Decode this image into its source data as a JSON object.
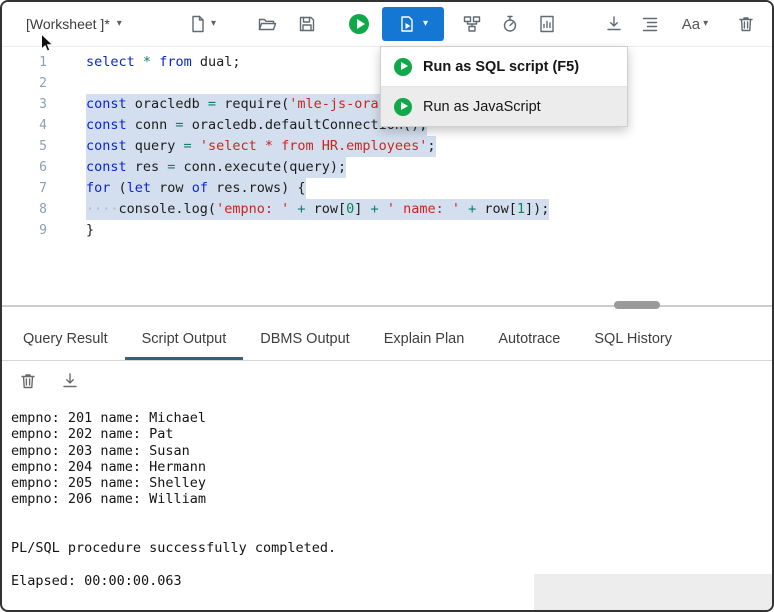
{
  "toolbar": {
    "worksheet_label": "[Worksheet ]*",
    "font_button_label": "Aa",
    "icons": [
      "new-worksheet",
      "open-file",
      "save",
      "run-statement",
      "run-script",
      "explain-plan",
      "autotrace",
      "serial-statements",
      "download",
      "format",
      "font-size",
      "clear"
    ]
  },
  "run_menu": {
    "items": [
      {
        "label": "Run as SQL script (F5)",
        "hovered": false,
        "emphasis": true
      },
      {
        "label": "Run as JavaScript",
        "hovered": true,
        "emphasis": false
      }
    ]
  },
  "editor": {
    "lines": [
      {
        "num": "1",
        "selected": false,
        "tokens": [
          {
            "t": "select",
            "c": "kw"
          },
          {
            "t": " ",
            "c": "pl"
          },
          {
            "t": "*",
            "c": "op"
          },
          {
            "t": " ",
            "c": "pl"
          },
          {
            "t": "from",
            "c": "kw"
          },
          {
            "t": " dual;",
            "c": "pl"
          }
        ]
      },
      {
        "num": "2",
        "selected": false,
        "tokens": []
      },
      {
        "num": "3",
        "selected": true,
        "tokens": [
          {
            "t": "const",
            "c": "kw"
          },
          {
            "t": " oracledb ",
            "c": "pl"
          },
          {
            "t": "=",
            "c": "op"
          },
          {
            "t": " require(",
            "c": "pl"
          },
          {
            "t": "'mle-js-oracledb'",
            "c": "str"
          },
          {
            "t": ");",
            "c": "pl"
          }
        ]
      },
      {
        "num": "4",
        "selected": true,
        "tokens": [
          {
            "t": "const",
            "c": "kw"
          },
          {
            "t": " conn ",
            "c": "pl"
          },
          {
            "t": "=",
            "c": "op"
          },
          {
            "t": " oracledb.defaultConnection();",
            "c": "pl"
          }
        ]
      },
      {
        "num": "5",
        "selected": true,
        "tokens": [
          {
            "t": "const",
            "c": "kw"
          },
          {
            "t": " query ",
            "c": "pl"
          },
          {
            "t": "=",
            "c": "op"
          },
          {
            "t": " ",
            "c": "pl"
          },
          {
            "t": "'select * from HR.employees'",
            "c": "str"
          },
          {
            "t": ";",
            "c": "pl"
          }
        ]
      },
      {
        "num": "6",
        "selected": true,
        "tokens": [
          {
            "t": "const",
            "c": "kw"
          },
          {
            "t": " res ",
            "c": "pl"
          },
          {
            "t": "=",
            "c": "op"
          },
          {
            "t": " conn.execute(query);",
            "c": "pl"
          }
        ]
      },
      {
        "num": "7",
        "selected": true,
        "tokens": [
          {
            "t": "for",
            "c": "kw"
          },
          {
            "t": " (",
            "c": "pl"
          },
          {
            "t": "let",
            "c": "kw"
          },
          {
            "t": " row ",
            "c": "pl"
          },
          {
            "t": "of",
            "c": "kw"
          },
          {
            "t": " res.rows) {",
            "c": "pl"
          }
        ]
      },
      {
        "num": "8",
        "selected": true,
        "tokens": [
          {
            "t": "····",
            "c": "ws"
          },
          {
            "t": "console.log(",
            "c": "pl"
          },
          {
            "t": "'empno: '",
            "c": "str"
          },
          {
            "t": " ",
            "c": "pl"
          },
          {
            "t": "+",
            "c": "op"
          },
          {
            "t": " row[",
            "c": "pl"
          },
          {
            "t": "0",
            "c": "num"
          },
          {
            "t": "] ",
            "c": "pl"
          },
          {
            "t": "+",
            "c": "op"
          },
          {
            "t": " ",
            "c": "pl"
          },
          {
            "t": "' name: '",
            "c": "str"
          },
          {
            "t": " ",
            "c": "pl"
          },
          {
            "t": "+",
            "c": "op"
          },
          {
            "t": " row[",
            "c": "pl"
          },
          {
            "t": "1",
            "c": "num"
          },
          {
            "t": "]);",
            "c": "pl"
          }
        ]
      },
      {
        "num": "9",
        "selected": false,
        "tokens": [
          {
            "t": "}",
            "c": "pl"
          }
        ]
      }
    ]
  },
  "result_tabs": [
    {
      "label": "Query Result",
      "active": false
    },
    {
      "label": "Script Output",
      "active": true
    },
    {
      "label": "DBMS Output",
      "active": false
    },
    {
      "label": "Explain Plan",
      "active": false
    },
    {
      "label": "Autotrace",
      "active": false
    },
    {
      "label": "SQL History",
      "active": false
    }
  ],
  "output": {
    "lines": [
      "empno: 201 name: Michael",
      "empno: 202 name: Pat",
      "empno: 203 name: Susan",
      "empno: 204 name: Hermann",
      "empno: 205 name: Shelley",
      "empno: 206 name: William",
      "",
      "",
      "PL/SQL procedure successfully completed.",
      "",
      "Elapsed: 00:00:00.063"
    ]
  },
  "colors": {
    "accent_blue": "#1477d4",
    "run_green": "#0fa94a",
    "selection": "#d3dfee",
    "keyword": "#0b24d8",
    "string": "#c8271d",
    "operator": "#0f7b6c",
    "number": "#098658",
    "tab_underline": "#3a6079"
  }
}
